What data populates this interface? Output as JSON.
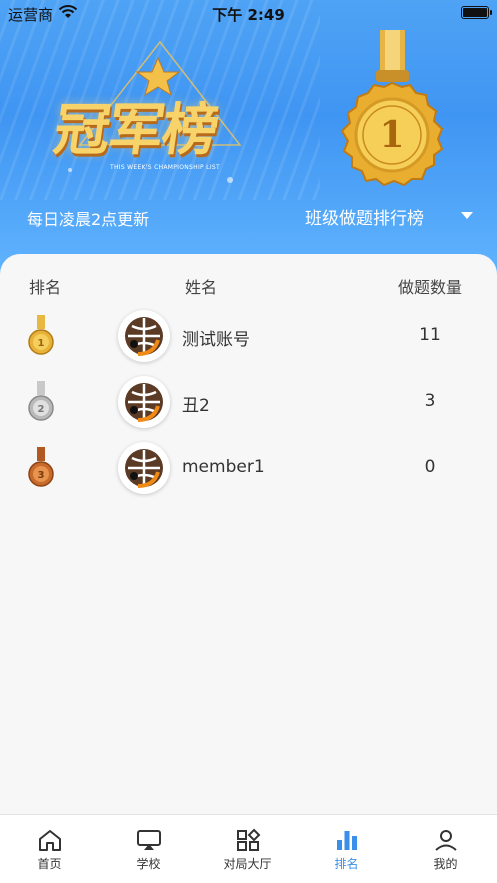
{
  "status_bar": {
    "carrier": "运营商",
    "time": "下午 2:49"
  },
  "hero": {
    "title": "冠军榜",
    "subtitle": "THIS WEEK'S CHAMPIONSHIP LIST",
    "big_medal_number": "1",
    "update_note": "每日凌晨2点更新",
    "dropdown_label": "班级做题排行榜"
  },
  "table": {
    "headers": {
      "rank": "排名",
      "name": "姓名",
      "count": "做题数量"
    },
    "rows": [
      {
        "rank": "1",
        "medal": "gold-medal-icon",
        "name": "测试账号",
        "count": "11"
      },
      {
        "rank": "2",
        "medal": "silver-medal-icon",
        "name": "丑2",
        "count": "3"
      },
      {
        "rank": "3",
        "medal": "bronze-medal-icon",
        "name": "member1",
        "count": "0"
      }
    ]
  },
  "tabbar": {
    "items": [
      {
        "label": "首页",
        "icon": "home-icon"
      },
      {
        "label": "学校",
        "icon": "school-icon"
      },
      {
        "label": "对局大厅",
        "icon": "lobby-icon"
      },
      {
        "label": "排名",
        "icon": "ranking-icon",
        "active": true
      },
      {
        "label": "我的",
        "icon": "profile-icon"
      }
    ]
  },
  "colors": {
    "accent": "#3a8fe8",
    "hero_blue": "#4fa3f5",
    "gold": "#e7b23a",
    "silver": "#b9b9b9",
    "bronze": "#c86a2c"
  }
}
